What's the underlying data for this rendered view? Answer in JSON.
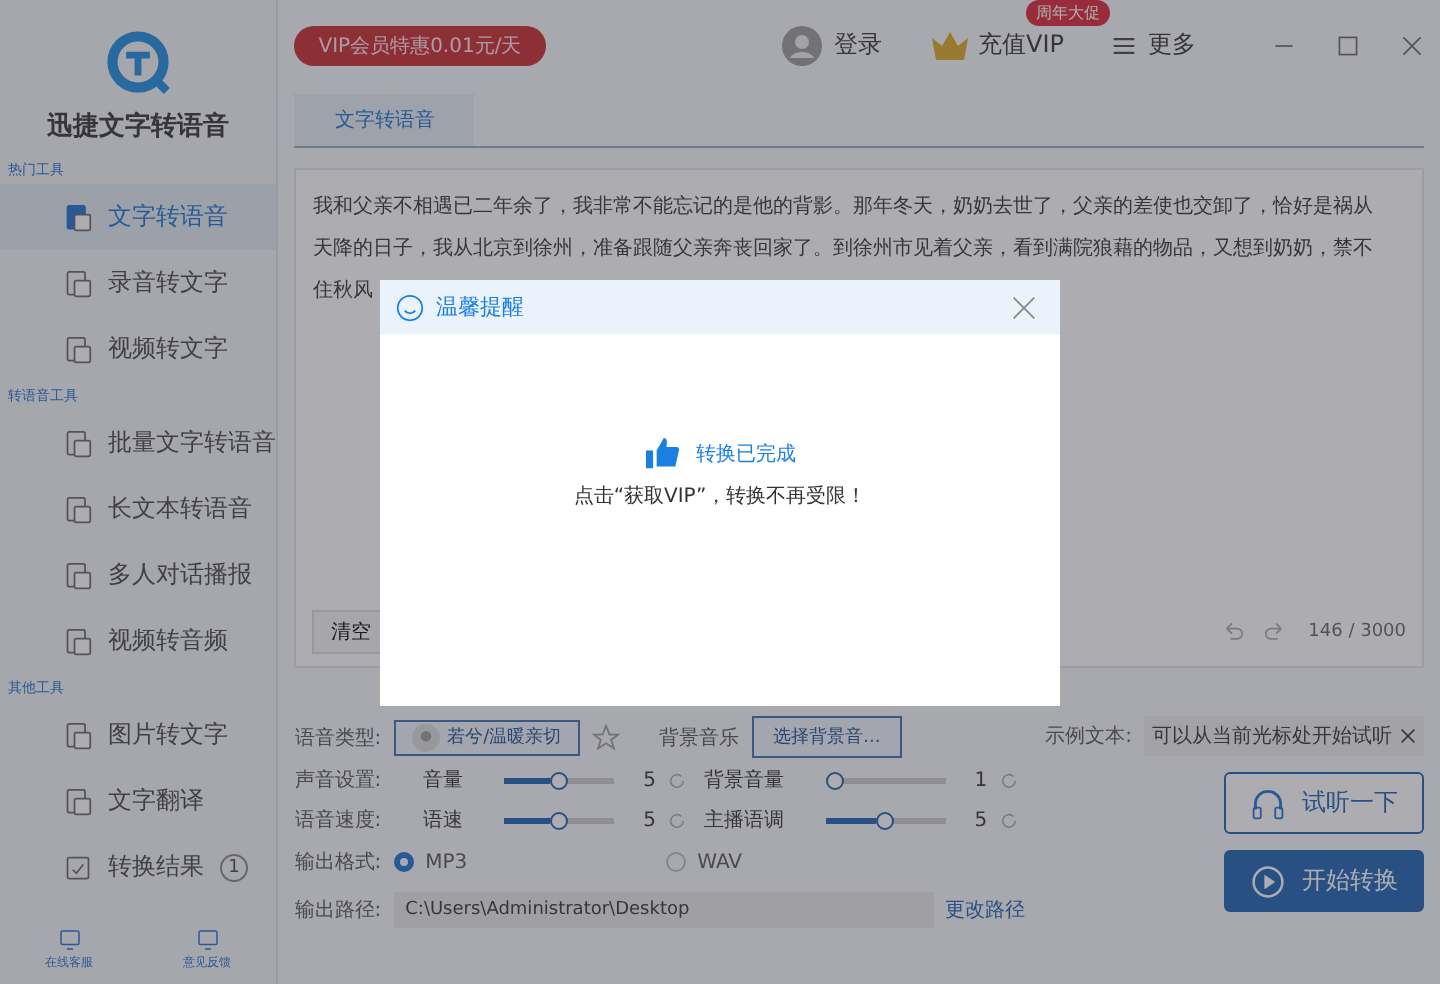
{
  "app": {
    "title": "迅捷文字转语音"
  },
  "sidebar": {
    "sections": [
      {
        "label": "热门工具",
        "items": [
          {
            "label": "文字转语音",
            "selected": true
          },
          {
            "label": "录音转文字",
            "selected": false
          },
          {
            "label": "视频转文字",
            "selected": false
          }
        ]
      },
      {
        "label": "转语音工具",
        "items": [
          {
            "label": "批量文字转语音",
            "selected": false
          },
          {
            "label": "长文本转语音",
            "selected": false
          },
          {
            "label": "多人对话播报",
            "selected": false
          },
          {
            "label": "视频转音频",
            "selected": false
          }
        ]
      },
      {
        "label": "其他工具",
        "items": [
          {
            "label": "图片转文字",
            "selected": false
          },
          {
            "label": "文字翻译",
            "selected": false
          }
        ]
      }
    ],
    "result": {
      "label": "转换结果",
      "badge": "1"
    },
    "footer": [
      {
        "label": "在线客服"
      },
      {
        "label": "意见反馈"
      }
    ]
  },
  "topbar": {
    "promo": "VIP会员特惠0.01元/天",
    "login": "登录",
    "vip": "充值VIP",
    "vip_badge": "周年大促",
    "more": "更多"
  },
  "tabs": [
    {
      "label": "文字转语音",
      "selected": true
    }
  ],
  "editor": {
    "lines": [
      "我和父亲不相遇已二年余了，我非常不能忘记的是他的背影。那年冬天，奶奶去世了，父亲的差使也交卸了，恰好是祸从",
      "天降的日子，我从北京到徐州，准备跟随父亲奔丧回家了。到徐州市见着父亲，看到满院狼藉的物品，又想到奶奶，禁不",
      "住秋风"
    ],
    "clear": "清空",
    "count": "146 / 3000"
  },
  "settings": {
    "voice_label": "语音类型:",
    "voice": "若兮/温暖亲切",
    "music_label": "背景音乐",
    "music_button": "选择背景音...",
    "sample_label": "示例文本:",
    "sample_value": "可以从当前光标处开始试听",
    "sliders": [
      {
        "row_label": "声音设置:",
        "label": "音量",
        "level": 0.5,
        "reading": "5"
      },
      {
        "label": "背景音量",
        "level": 0,
        "reading": "1"
      },
      {
        "row_label": "语音速度:",
        "label": "语速",
        "level": 0.5,
        "reading": "5"
      },
      {
        "label": "主播语调",
        "level": 0.5,
        "reading": "5"
      }
    ],
    "format_label": "输出格式:",
    "formats": [
      {
        "label": "MP3",
        "selected": true
      },
      {
        "label": "WAV",
        "selected": false
      }
    ],
    "path_label": "输出路径:",
    "path": "C:\\Users\\Administrator\\Desktop",
    "change_path": "更改路径",
    "preview": "试听一下",
    "start": "开始转换"
  },
  "dialog": {
    "title": "温馨提醒",
    "status": "转换已完成",
    "message": "点击“获取VIP”，转换不再受限！"
  }
}
